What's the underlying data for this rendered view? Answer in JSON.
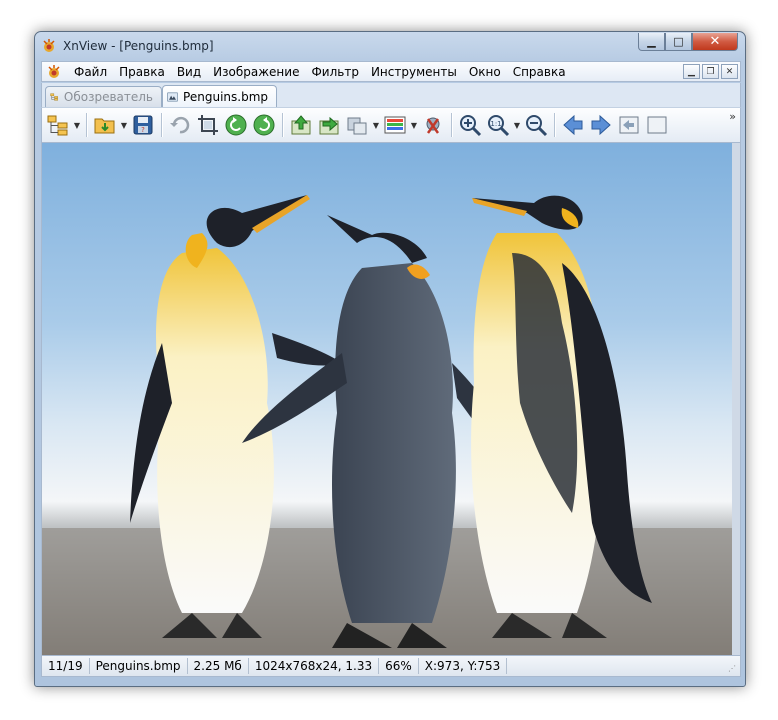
{
  "window": {
    "title": "XnView - [Penguins.bmp]"
  },
  "menu": {
    "items": [
      "Файл",
      "Правка",
      "Вид",
      "Изображение",
      "Фильтр",
      "Инструменты",
      "Окно",
      "Справка"
    ]
  },
  "tabs": [
    {
      "label": "Обозреватель",
      "active": false
    },
    {
      "label": "Penguins.bmp",
      "active": true
    }
  ],
  "toolbar": {
    "icons": [
      "browser-icon",
      "open-folder-icon",
      "save-icon",
      "undo-icon",
      "crop-icon",
      "rotate-left-icon",
      "rotate-right-icon",
      "previous-file-icon",
      "next-file-icon",
      "resize-icon",
      "color-adjust-icon",
      "zoom-in-icon",
      "zoom-1to1-icon",
      "zoom-out-icon",
      "arrow-left-icon",
      "arrow-right-icon",
      "first-image-icon",
      "last-image-icon"
    ]
  },
  "status": {
    "index": "11/19",
    "filename": "Penguins.bmp",
    "filesize": "2.25 Мб",
    "dimensions": "1024x768x24, 1.33",
    "zoom": "66%",
    "coords": "X:973, Y:753"
  },
  "colors": {
    "accent": "#3c7fb1",
    "sky": "#9fc4e6",
    "sand": "#8f8a83"
  }
}
